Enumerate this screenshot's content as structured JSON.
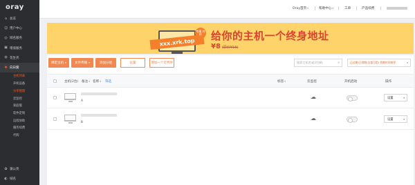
{
  "sidebar": {
    "logo": "oray",
    "items": [
      {
        "label": "总览",
        "icon": "home-icon",
        "glyph": "⌂"
      },
      {
        "label": "用户中心",
        "icon": "user-icon",
        "glyph": "☺"
      },
      {
        "label": "域名服务",
        "icon": "globe-icon",
        "glyph": "◎"
      },
      {
        "label": "增值服务",
        "icon": "cart-icon",
        "glyph": "▣"
      },
      {
        "label": "花生壳",
        "icon": "peanut-icon",
        "glyph": "◍"
      },
      {
        "label": "向日葵",
        "icon": "sunflower-icon",
        "glyph": "✺"
      }
    ],
    "sub_items": [
      {
        "label": "主机列表"
      },
      {
        "label": "开机设备"
      },
      {
        "label": "分享管理"
      },
      {
        "label": "云监控"
      },
      {
        "label": "家庭版"
      },
      {
        "label": "软件定制"
      },
      {
        "label": "远程协助"
      },
      {
        "label": "服务续费"
      },
      {
        "label": "代购"
      }
    ],
    "bottom_items": [
      {
        "label": "蒲公英",
        "icon": "dandelion-icon",
        "glyph": "✿"
      },
      {
        "label": "域名",
        "icon": "domain-icon",
        "glyph": "◐"
      }
    ]
  },
  "topbar": {
    "links": [
      {
        "label": "Oray首页",
        "caret": "▾"
      },
      {
        "label": "帮助中心",
        "caret": "▾"
      },
      {
        "label": "工单",
        "caret": ""
      },
      {
        "label": "产品续费",
        "caret": ""
      }
    ]
  },
  "banner": {
    "domain_text": "xxx.xrk.top",
    "badge": "专属 特价",
    "headline": "给你的主机一个终身地址",
    "price": "¥8",
    "original_price": "(原价¥16)"
  },
  "toolbar": {
    "buttons": [
      {
        "label": "绑定主机",
        "caret": "▾"
      },
      {
        "label": "文件传输",
        "caret": "▾"
      },
      {
        "label": "添加分组",
        "caret": ""
      },
      {
        "label": "设置",
        "caret": ""
      },
      {
        "label": "增加一个可用项",
        "caret": ""
      }
    ],
    "search_placeholder": "搜索主机名或识别码",
    "filter_text": "已过期/已到期(全部可用) 到期时间排序",
    "filter_caret": "▾",
    "search_icon": "⌕"
  },
  "table": {
    "headers": {
      "host": "主机(2台)",
      "sort": "备注",
      "name": "名称",
      "ok": "筛选",
      "tag": "标签",
      "cloud": "云监控",
      "autostart": "开机启动",
      "action": "操作"
    },
    "carets": {
      "sort": "▾",
      "name": "▾",
      "tag": "▾"
    },
    "rows": [
      {
        "label": "A",
        "cloud_glyph": "☁",
        "action": "设置",
        "caret": "▾"
      },
      {
        "label": "B",
        "cloud_glyph": "☁",
        "action": "设置",
        "caret": "▾"
      }
    ]
  },
  "colors": {
    "accent": "#f08850",
    "sidebar_bg": "#2b2d30",
    "banner_bg": "#fdd36a",
    "headline": "#d9432f"
  }
}
